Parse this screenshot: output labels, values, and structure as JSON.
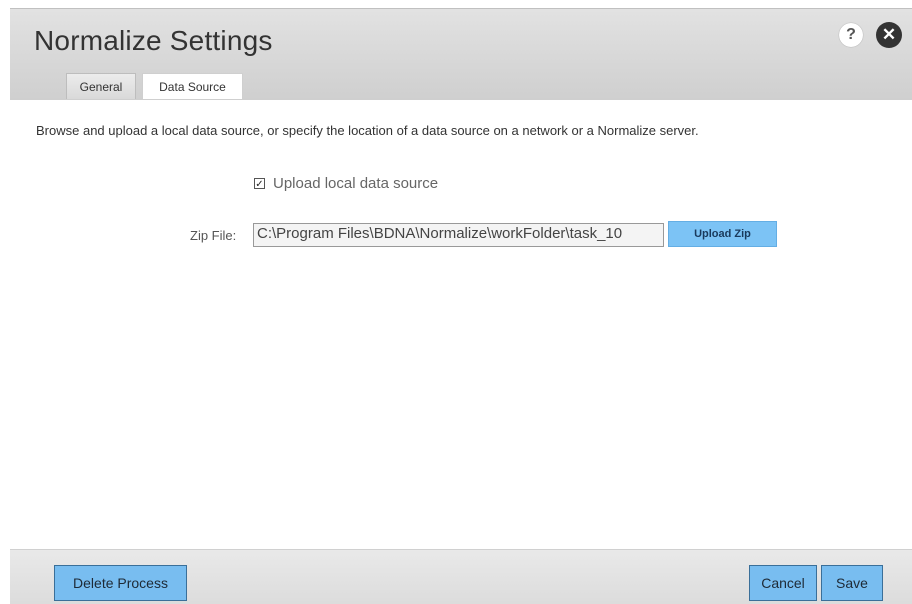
{
  "dialog": {
    "title": "Normalize Settings",
    "help_icon": "?",
    "close_icon": "✕"
  },
  "tabs": [
    {
      "label": "General",
      "active": false
    },
    {
      "label": "Data Source",
      "active": true
    }
  ],
  "content": {
    "description": "Browse and upload a local data source, or specify the location of a data source on a network or a Normalize server.",
    "upload_checkbox": {
      "checked": true,
      "mark": "✓",
      "label": "Upload local data source"
    },
    "zip_file": {
      "label": "Zip File:",
      "value": "C:\\Program Files\\BDNA\\Normalize\\workFolder\\task_10"
    },
    "upload_zip_label": "Upload Zip"
  },
  "footer": {
    "delete_label": "Delete Process",
    "cancel_label": "Cancel",
    "save_label": "Save"
  },
  "colors": {
    "accent_button": "#78bdf0",
    "header_bg": "#d8d8d8"
  }
}
